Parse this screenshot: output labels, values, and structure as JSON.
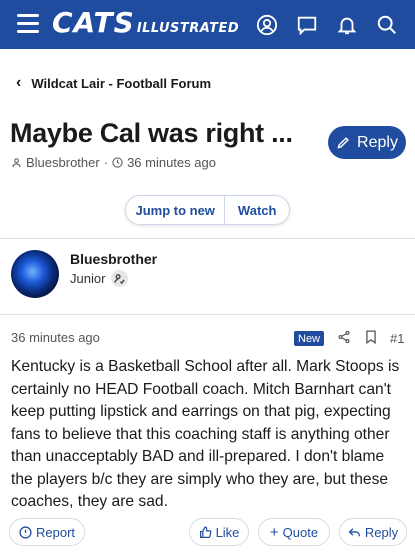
{
  "header": {
    "logo_main": "CATS",
    "logo_sub": "ILLUSTRATED",
    "icons": [
      "menu-icon",
      "account-icon",
      "chat-icon",
      "bell-icon",
      "search-icon"
    ],
    "brand_color": "#1f4c9e"
  },
  "breadcrumb": {
    "label": "Wildcat Lair - Football Forum"
  },
  "thread": {
    "title": "Maybe Cal was right ...",
    "author": "Bluesbrother",
    "time": "36 minutes ago",
    "reply_label": "Reply"
  },
  "controls": {
    "jump_label": "Jump to new",
    "watch_label": "Watch"
  },
  "post": {
    "author": "Bluesbrother",
    "rank": "Junior",
    "time": "36 minutes ago",
    "badge": "New",
    "number": "#1",
    "body": "Kentucky is a Basketball School after all. Mark Stoops is certainly no HEAD Football coach. Mitch Barnhart can't keep putting lipstick and earrings on that pig, expecting fans to believe that this coaching staff is anything other than unacceptably BAD and ill-prepared. I don't blame the players b/c they are simply who they are, but these coaches, they are sad.",
    "actions": {
      "report": "Report",
      "like": "Like",
      "quote": "Quote",
      "reply": "Reply"
    }
  }
}
